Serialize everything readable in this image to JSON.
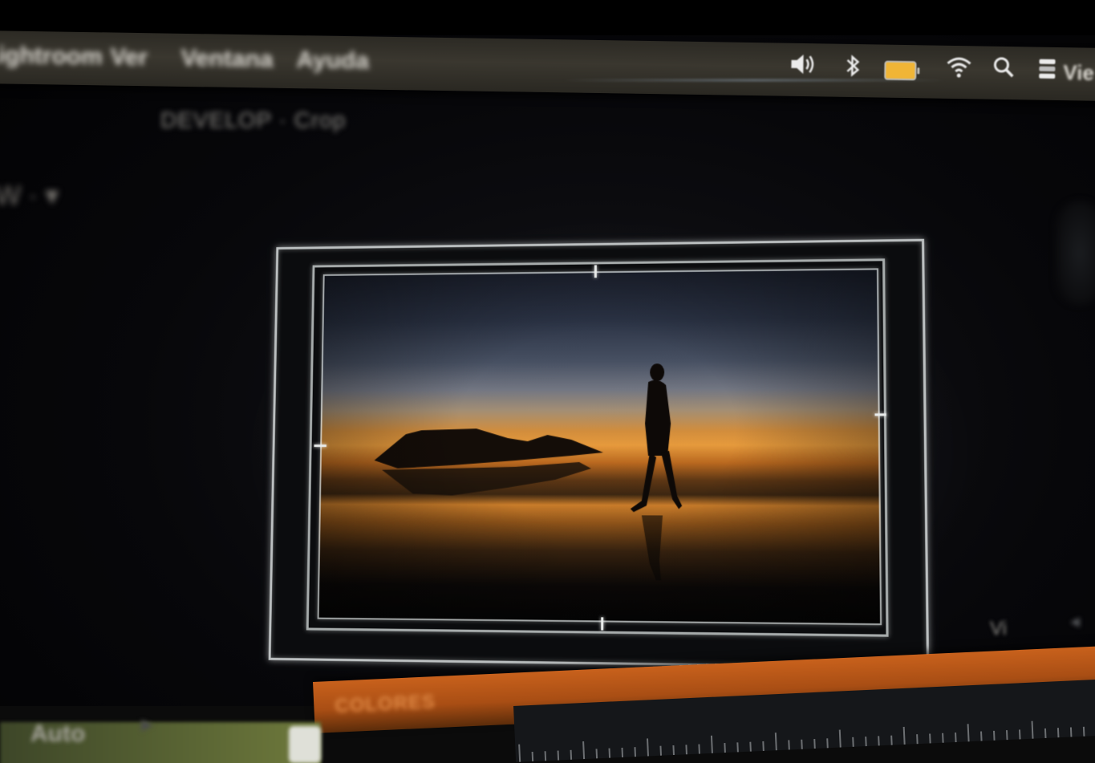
{
  "menubar": {
    "items": [
      {
        "label": "Lightroom"
      },
      {
        "label": "Ver"
      },
      {
        "label": "Ventana"
      },
      {
        "label": "Ayuda"
      }
    ],
    "status": {
      "volume_icon": "speaker-icon",
      "bluetooth_icon": "bluetooth-icon",
      "battery_icon": "battery-icon",
      "wifi_icon": "wifi-icon",
      "search_icon": "search-icon",
      "control_icon": "control-center-icon",
      "clock_text": "Vie"
    }
  },
  "header": {
    "title": "DEVELOP · Crop",
    "side_text": "W · ▾"
  },
  "crop": {
    "photo_description_icon": "photo-preview-icon"
  },
  "toolbar": {
    "auto_label": "Auto",
    "arrow_label": "▸",
    "timeline_label": "COLORES",
    "right_label": "Vi",
    "right_arrow": "◂"
  },
  "colors": {
    "menubar": "#3a372f",
    "battery": "#f0b536",
    "timeline": "#c8611c",
    "frame": "#e6ebeb",
    "sky_top": "#1d2230",
    "horizon": "#e69a3c"
  }
}
